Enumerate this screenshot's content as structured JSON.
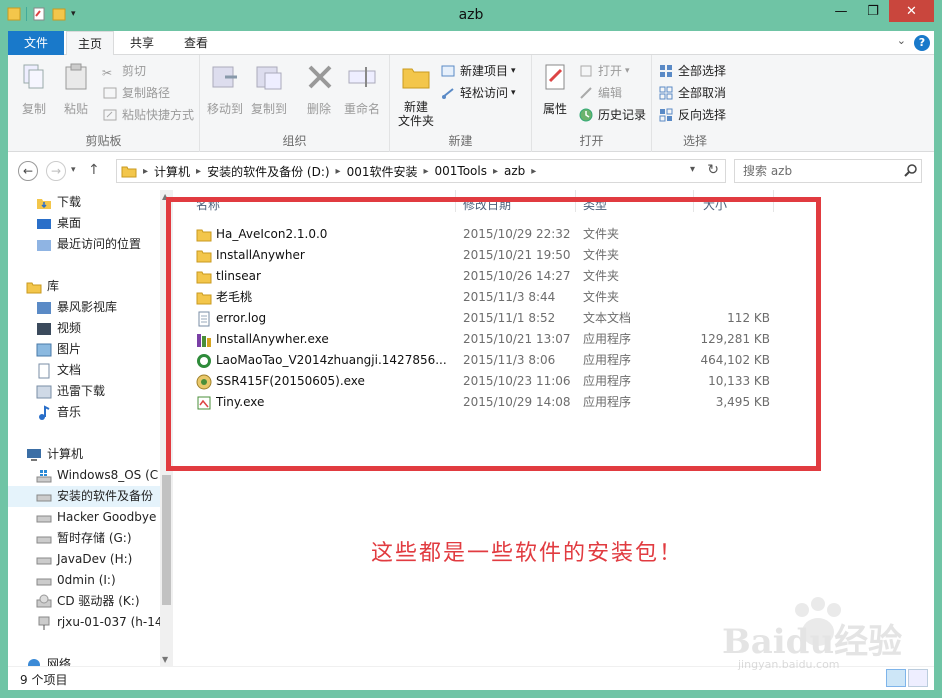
{
  "window": {
    "title": "azb"
  },
  "tabs": {
    "file": "文件",
    "home": "主页",
    "share": "共享",
    "view": "查看"
  },
  "ribbon": {
    "clipboard": {
      "label": "剪贴板",
      "copy": "复制",
      "paste": "粘贴",
      "cut": "剪切",
      "copy_path": "复制路径",
      "paste_shortcut": "粘贴快捷方式"
    },
    "organize": {
      "label": "组织",
      "move_to": "移动到",
      "copy_to": "复制到",
      "delete": "删除",
      "rename": "重命名"
    },
    "new": {
      "label": "新建",
      "new_folder": "新建\n文件夹",
      "new_item": "新建项目",
      "easy_access": "轻松访问"
    },
    "open": {
      "label": "打开",
      "properties": "属性",
      "open": "打开",
      "edit": "编辑",
      "history": "历史记录"
    },
    "select": {
      "label": "选择",
      "select_all": "全部选择",
      "select_none": "全部取消",
      "invert": "反向选择"
    }
  },
  "address": {
    "crumbs": [
      "计算机",
      "安装的软件及备份 (D:)",
      "001软件安装",
      "001Tools",
      "azb"
    ],
    "search_placeholder": "搜索 azb"
  },
  "nav": {
    "items": [
      {
        "label": "下载",
        "icon": "download-folder-icon"
      },
      {
        "label": "桌面",
        "icon": "desktop-icon"
      },
      {
        "label": "最近访问的位置",
        "icon": "recent-places-icon"
      },
      {
        "label": "库",
        "icon": "library-icon"
      },
      {
        "label": "暴风影视库",
        "icon": "video-library-icon"
      },
      {
        "label": "视频",
        "icon": "videos-icon"
      },
      {
        "label": "图片",
        "icon": "pictures-icon"
      },
      {
        "label": "文档",
        "icon": "documents-icon"
      },
      {
        "label": "迅雷下载",
        "icon": "xunlei-icon"
      },
      {
        "label": "音乐",
        "icon": "music-icon"
      },
      {
        "label": "计算机",
        "icon": "computer-icon"
      },
      {
        "label": "Windows8_OS (C",
        "icon": "windows-drive-icon"
      },
      {
        "label": "安装的软件及备份",
        "icon": "drive-icon"
      },
      {
        "label": "Hacker Goodbye",
        "icon": "drive-icon"
      },
      {
        "label": "暂时存储 (G:)",
        "icon": "drive-icon"
      },
      {
        "label": "JavaDev (H:)",
        "icon": "drive-icon"
      },
      {
        "label": "0dmin (I:)",
        "icon": "drive-icon"
      },
      {
        "label": "CD 驱动器 (K:)",
        "icon": "cd-drive-icon"
      },
      {
        "label": "rjxu-01-037 (h-14",
        "icon": "network-drive-icon"
      },
      {
        "label": "网络",
        "icon": "network-icon"
      }
    ]
  },
  "columns": {
    "name": "名称",
    "date": "修改日期",
    "type": "类型",
    "size": "大小"
  },
  "files": [
    {
      "name": "Ha_AveIcon2.1.0.0",
      "date": "2015/10/29 22:32",
      "type": "文件夹",
      "size": "",
      "icon": "folder-icon"
    },
    {
      "name": "InstallAnywher",
      "date": "2015/10/21 19:50",
      "type": "文件夹",
      "size": "",
      "icon": "folder-icon"
    },
    {
      "name": "tlinsear",
      "date": "2015/10/26 14:27",
      "type": "文件夹",
      "size": "",
      "icon": "folder-icon"
    },
    {
      "name": "老毛桃",
      "date": "2015/11/3 8:44",
      "type": "文件夹",
      "size": "",
      "icon": "folder-icon"
    },
    {
      "name": "error.log",
      "date": "2015/11/1 8:52",
      "type": "文本文档",
      "size": "112 KB",
      "icon": "text-file-icon"
    },
    {
      "name": "InstallAnywher.exe",
      "date": "2015/10/21 13:07",
      "type": "应用程序",
      "size": "129,281 KB",
      "icon": "installer-icon"
    },
    {
      "name": "LaoMaoTao_V2014zhuangji.1427856...",
      "date": "2015/11/3 8:06",
      "type": "应用程序",
      "size": "464,102 KB",
      "icon": "laomaotao-icon"
    },
    {
      "name": "SSR415F(20150605).exe",
      "date": "2015/10/23 11:06",
      "type": "应用程序",
      "size": "10,133 KB",
      "icon": "ssr-app-icon"
    },
    {
      "name": "Tiny.exe",
      "date": "2015/10/29 14:08",
      "type": "应用程序",
      "size": "3,495 KB",
      "icon": "tiny-app-icon"
    }
  ],
  "status": {
    "count": "9 个项目"
  },
  "annotation": {
    "text": "这些都是一些软件的安装包！"
  },
  "watermark": {
    "brand": "Baidu经验",
    "url": "jingyan.baidu.com"
  },
  "colors": {
    "accent": "#1979ca",
    "title_bg": "#6fc4a5",
    "highlight": "#e13b40"
  }
}
